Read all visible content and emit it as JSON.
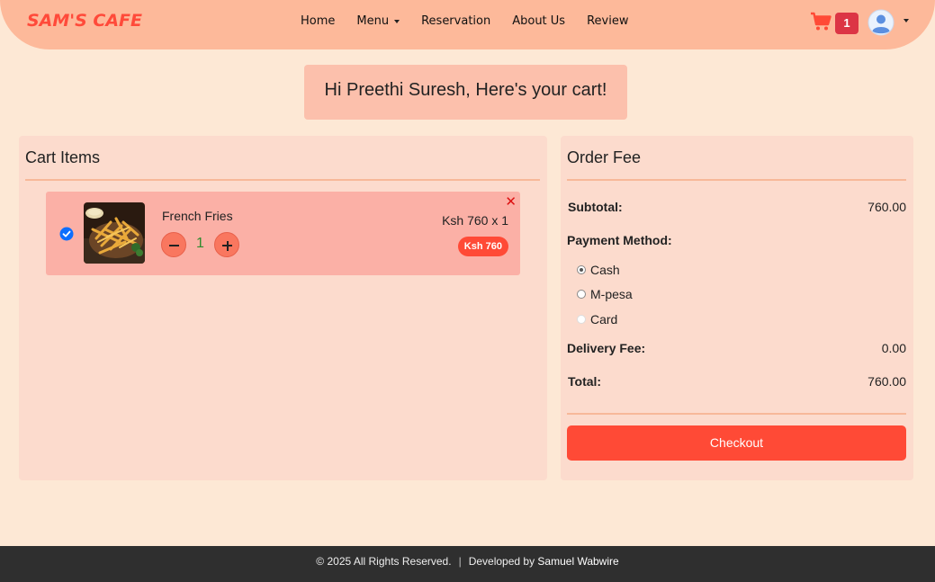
{
  "brand": "SAM'S CAFE",
  "nav": {
    "items": [
      {
        "label": "Home"
      },
      {
        "label": "Menu"
      },
      {
        "label": "Reservation"
      },
      {
        "label": "About Us"
      },
      {
        "label": "Review"
      }
    ],
    "cart_count": "1"
  },
  "greeting": "Hi Preethi Suresh, Here's your cart!",
  "cart": {
    "title": "Cart Items",
    "items": [
      {
        "name": "French Fries",
        "quantity": "1",
        "price_line": "Ksh 760 x 1",
        "total": "Ksh 760",
        "remove_symbol": "✕",
        "selected": true
      }
    ]
  },
  "order": {
    "title": "Order Fee",
    "subtotal_label": "Subtotal:",
    "subtotal_value": "760.00",
    "payment_label": "Payment Method:",
    "payment_options": [
      "Cash",
      "M-pesa",
      "Card"
    ],
    "payment_selected": "Cash",
    "delivery_label": "Delivery Fee:",
    "delivery_value": "0.00",
    "total_label": "Total:",
    "total_value": "760.00",
    "checkout_label": "Checkout"
  },
  "footer": {
    "copyright": "© 2025 All Rights Reserved.",
    "separator": "|",
    "developed_by": "Developed by",
    "developer": "Samuel Wabwire"
  },
  "colors": {
    "page_bg": "#fde8d5",
    "navbar": "#fdb99a",
    "accent": "#ff4a36",
    "panel": "#fcdbcd",
    "cart_item": "#fbb0a6",
    "badge": "#dc3545",
    "footer": "#2f2f2f"
  },
  "icons": [
    "cart-icon",
    "user-avatar-icon",
    "checkbox-checked-icon",
    "minus-icon",
    "plus-icon",
    "close-icon"
  ]
}
